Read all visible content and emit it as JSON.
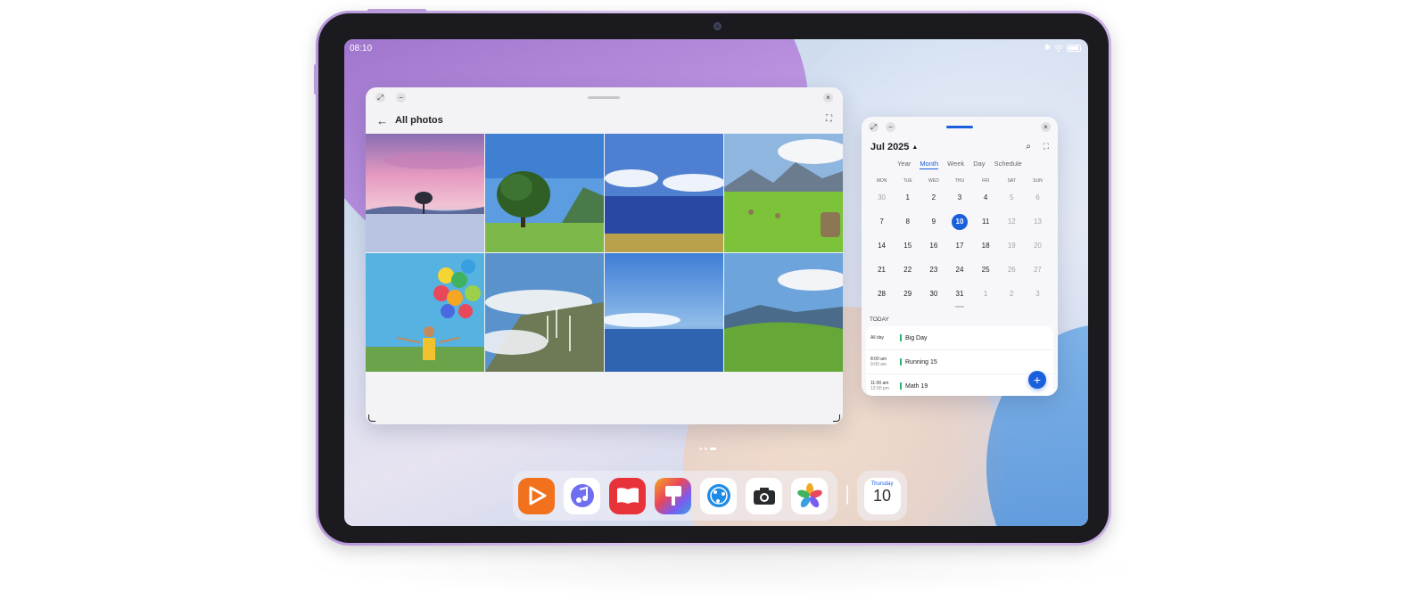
{
  "status_bar": {
    "time": "08:10"
  },
  "photos_window": {
    "title": "All photos",
    "photos": [
      {
        "name": "lake-tree-sunset"
      },
      {
        "name": "tree-in-meadow"
      },
      {
        "name": "sea-and-clouds"
      },
      {
        "name": "hay-bales-mountains"
      },
      {
        "name": "girl-with-balloons"
      },
      {
        "name": "wind-turbines-clouds"
      },
      {
        "name": "ocean-horizon"
      },
      {
        "name": "green-hills"
      }
    ]
  },
  "calendar_window": {
    "month_label": "Jul 2025",
    "views": [
      "Year",
      "Month",
      "Week",
      "Day",
      "Schedule"
    ],
    "active_view": "Month",
    "weekdays": [
      "MON",
      "TUE",
      "WED",
      "THU",
      "FRI",
      "SAT",
      "SUN"
    ],
    "days": [
      {
        "d": "30",
        "muted": true
      },
      {
        "d": "1"
      },
      {
        "d": "2"
      },
      {
        "d": "3"
      },
      {
        "d": "4"
      },
      {
        "d": "5",
        "muted": true
      },
      {
        "d": "6",
        "muted": true
      },
      {
        "d": "7"
      },
      {
        "d": "8"
      },
      {
        "d": "9"
      },
      {
        "d": "10",
        "today": true
      },
      {
        "d": "11"
      },
      {
        "d": "12",
        "muted": true
      },
      {
        "d": "13",
        "muted": true
      },
      {
        "d": "14"
      },
      {
        "d": "15"
      },
      {
        "d": "16"
      },
      {
        "d": "17"
      },
      {
        "d": "18"
      },
      {
        "d": "19",
        "muted": true
      },
      {
        "d": "20",
        "muted": true
      },
      {
        "d": "21"
      },
      {
        "d": "22"
      },
      {
        "d": "23"
      },
      {
        "d": "24"
      },
      {
        "d": "25"
      },
      {
        "d": "26",
        "muted": true
      },
      {
        "d": "27",
        "muted": true
      },
      {
        "d": "28"
      },
      {
        "d": "29"
      },
      {
        "d": "30"
      },
      {
        "d": "31"
      },
      {
        "d": "1",
        "muted": true
      },
      {
        "d": "2",
        "muted": true
      },
      {
        "d": "3",
        "muted": true
      }
    ],
    "section_label": "TODAY",
    "events": [
      {
        "time": "All day",
        "time2": "",
        "name": "Big Day"
      },
      {
        "time": "8:00 am",
        "time2": "9:00 am",
        "name": "Running 15"
      },
      {
        "time": "11:00 am",
        "time2": "12:00 pm",
        "name": "Math 19"
      }
    ]
  },
  "dock": {
    "apps": [
      {
        "name": "video-app-icon",
        "bg": "#f2711c"
      },
      {
        "name": "music-app-icon",
        "bg": "#ffffff"
      },
      {
        "name": "books-app-icon",
        "bg": "#e8323a"
      },
      {
        "name": "themes-app-icon",
        "bg": "#7b5cf0"
      },
      {
        "name": "browser-app-icon",
        "bg": "#ffffff"
      },
      {
        "name": "camera-app-icon",
        "bg": "#ffffff"
      },
      {
        "name": "gallery-app-icon",
        "bg": "#ffffff"
      }
    ],
    "calendar_app": {
      "weekday": "Thursday",
      "day": "10"
    }
  },
  "colors": {
    "accent": "#1a5fdc",
    "tablet_frame": "#c8afe4"
  }
}
